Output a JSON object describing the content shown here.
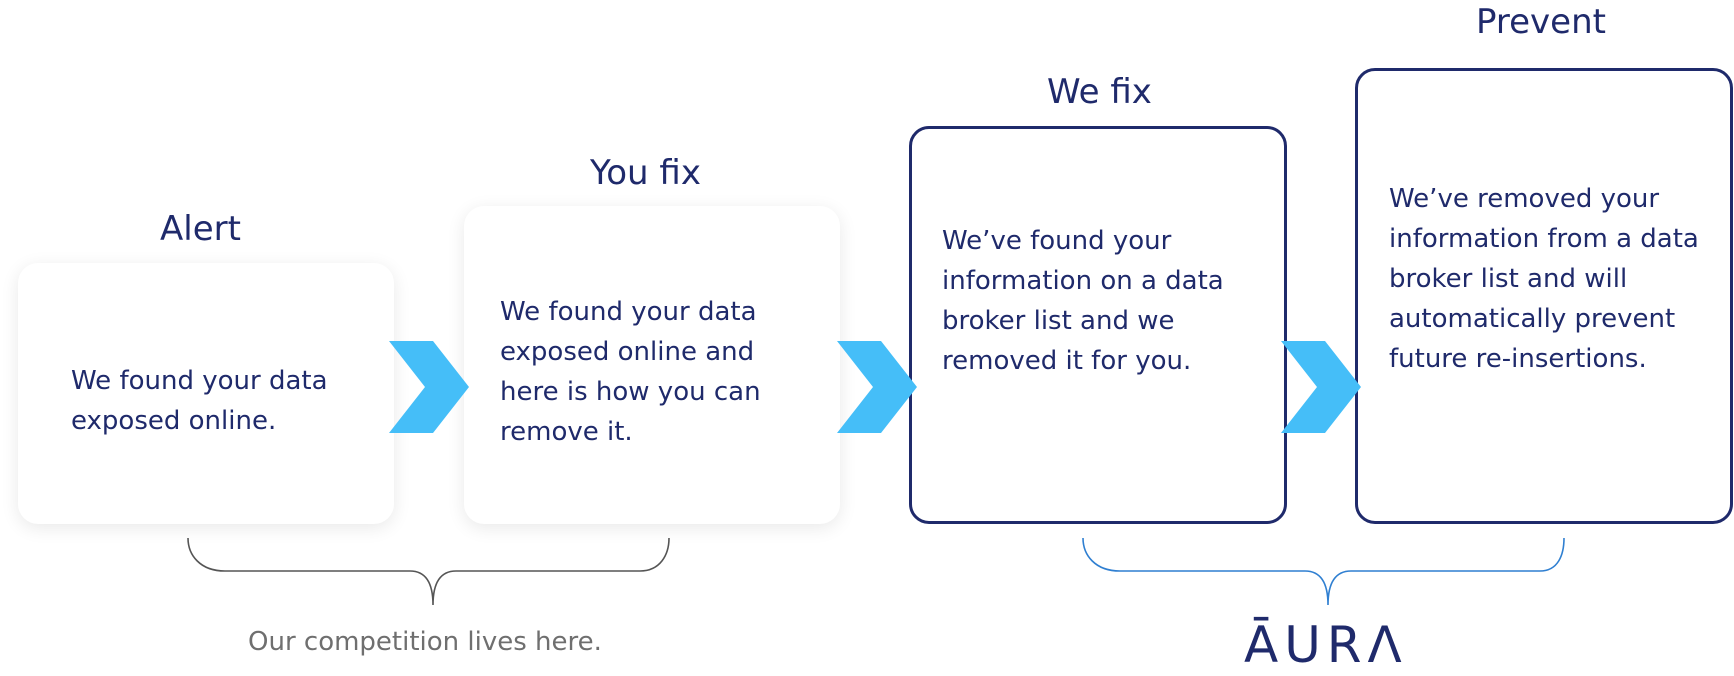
{
  "steps": [
    {
      "title": "Alert",
      "text": "We found your data\nexposed online."
    },
    {
      "title": "You fix",
      "text": " We found your data\nexposed online and\nhere is how you can\nremove it."
    },
    {
      "title": "We fix",
      "text": "We’ve found your\ninformation on a data\nbroker list and we\nremoved it for you."
    },
    {
      "title": "Prevent",
      "text": "We’ve removed your\ninformation from a data\nbroker list and will\nautomatically prevent\nfuture re-insertions."
    }
  ],
  "competition_caption": "Our competition lives here.",
  "brand_logo": "ĀURΛ",
  "colors": {
    "navy": "#1f2a6b",
    "chevron": "#45bef8",
    "competition_brace": "#555555",
    "aura_brace": "#2f7fd1",
    "caption": "#6f6f6f"
  }
}
